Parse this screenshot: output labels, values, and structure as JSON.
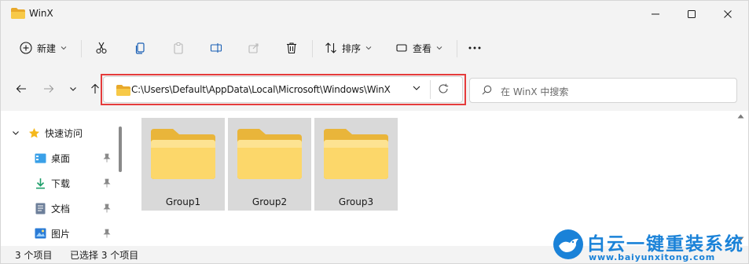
{
  "window": {
    "title": "WinX",
    "controls": [
      "minimize",
      "maximize",
      "close"
    ]
  },
  "toolbar": {
    "new_label": "新建",
    "sort_label": "排序",
    "view_label": "查看",
    "more_label": "···"
  },
  "address": {
    "path": "C:\\Users\\Default\\AppData\\Local\\Microsoft\\Windows\\WinX"
  },
  "search": {
    "placeholder": "在 WinX 中搜索"
  },
  "sidebar": {
    "items": [
      {
        "label": "快速访问",
        "icon": "star-icon"
      },
      {
        "label": "桌面",
        "icon": "desktop-icon",
        "pinned": true
      },
      {
        "label": "下载",
        "icon": "download-icon",
        "pinned": true
      },
      {
        "label": "文档",
        "icon": "document-icon",
        "pinned": true
      },
      {
        "label": "图片",
        "icon": "picture-icon",
        "pinned": true
      }
    ]
  },
  "files": [
    {
      "name": "Group1"
    },
    {
      "name": "Group2"
    },
    {
      "name": "Group3"
    }
  ],
  "status": {
    "count": "3 个项目",
    "selected": "已选择 3 个项目"
  },
  "watermark": {
    "title": "白云一键重装系统",
    "url": "www.baiyunxitong.com"
  },
  "colors": {
    "highlight": "#e53c3c",
    "folder": "#f7c948",
    "watermark": "#1a82d8",
    "tile_selected": "#d9d9d9"
  }
}
